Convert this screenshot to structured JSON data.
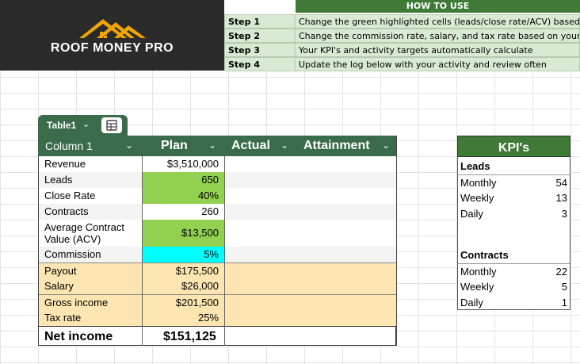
{
  "logo": {
    "text": "ROOF MONEY PRO"
  },
  "howto": {
    "title": "HOW TO USE",
    "steps": [
      {
        "label": "Step 1",
        "text": "Change the green highlighted cells (leads/close rate/ACV) based on"
      },
      {
        "label": "Step 2",
        "text": "Change the commission rate, salary, and tax rate based on your sit"
      },
      {
        "label": "Step 3",
        "text": "Your KPI's and activity targets automatically calculate"
      },
      {
        "label": "Step 4",
        "text": "Update the log below with your activity and review often"
      }
    ]
  },
  "table": {
    "tab_name": "Table1",
    "headers": [
      "Column 1",
      "Plan",
      "Actual",
      "Attainment"
    ],
    "rows": [
      {
        "label": "Revenue",
        "plan": "$3,510,000"
      },
      {
        "label": "Leads",
        "plan": "650"
      },
      {
        "label": "Close Rate",
        "plan": "40%"
      },
      {
        "label": "Contracts",
        "plan": "260"
      },
      {
        "label": "Average Contract Value (ACV)",
        "plan": "$13,500"
      },
      {
        "label": "Commission",
        "plan": "5%"
      },
      {
        "label": "Payout",
        "plan": "$175,500"
      },
      {
        "label": "Salary",
        "plan": "$26,000"
      },
      {
        "label": "Gross income",
        "plan": "$201,500"
      },
      {
        "label": "Tax rate",
        "plan": "25%"
      },
      {
        "label": "Net income",
        "plan": "$151,125"
      }
    ]
  },
  "kpi": {
    "title": "KPI's",
    "leads": {
      "heading": "Leads",
      "rows": [
        {
          "label": "Monthly",
          "value": "54"
        },
        {
          "label": "Weekly",
          "value": "13"
        },
        {
          "label": "Daily",
          "value": "3"
        }
      ]
    },
    "contracts": {
      "heading": "Contracts",
      "rows": [
        {
          "label": "Monthly",
          "value": "22"
        },
        {
          "label": "Weekly",
          "value": "5"
        },
        {
          "label": "Daily",
          "value": "1"
        }
      ]
    }
  },
  "colors": {
    "header_green": "#3a6b4a",
    "input_green": "#92d050",
    "commission_cyan": "#00ffff",
    "payout_tan": "#fce5b0",
    "howto_green": "#d9ead3"
  }
}
